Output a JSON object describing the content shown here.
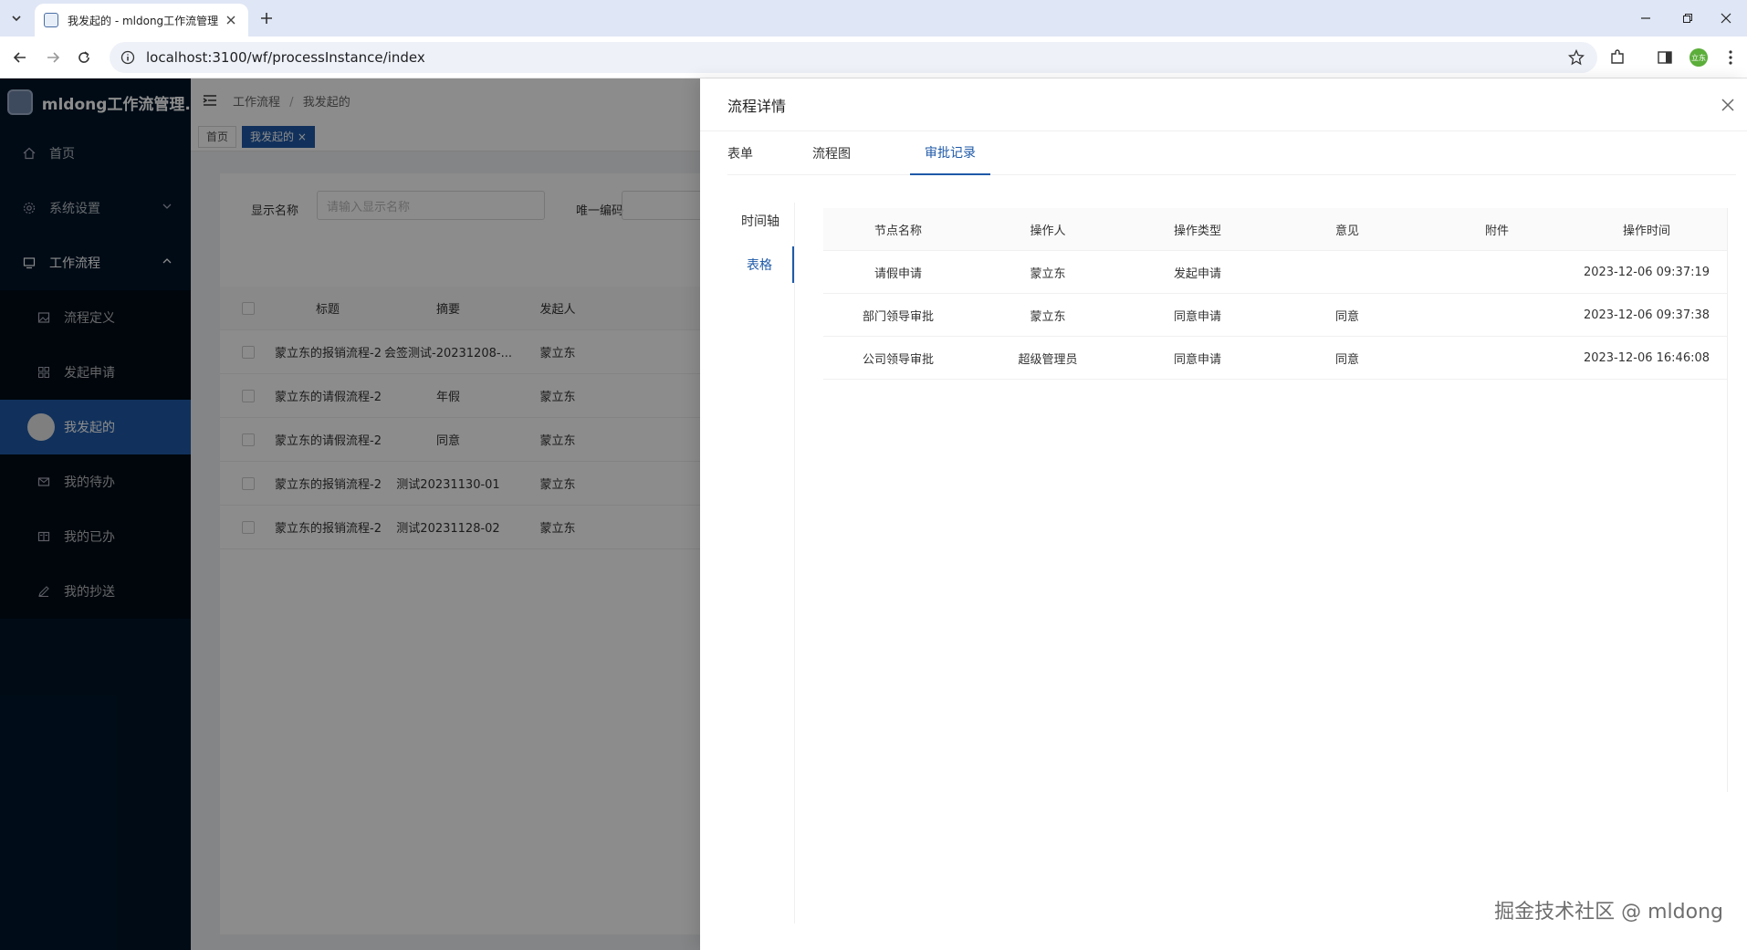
{
  "browser": {
    "tab_title": "我发起的 - mldong工作流管理",
    "url": "localhost:3100/wf/processInstance/index",
    "profile_text": "立东"
  },
  "app": {
    "brand": "mldong工作流管理...",
    "breadcrumb": [
      "工作流程",
      "我发起的"
    ],
    "open_tags": [
      {
        "label": "首页"
      },
      {
        "label": "我发起的 ×"
      }
    ]
  },
  "sidebar": {
    "items": [
      {
        "label": "首页",
        "icon": "home-icon"
      },
      {
        "label": "系统设置",
        "icon": "gear-icon"
      },
      {
        "label": "工作流程",
        "icon": "desktop-icon"
      }
    ],
    "sub_items": [
      {
        "label": "流程定义",
        "icon": "picture-icon"
      },
      {
        "label": "发起申请",
        "icon": "apps-icon"
      },
      {
        "label": "我发起的",
        "icon": "circle-icon"
      },
      {
        "label": "我的待办",
        "icon": "mail-icon"
      },
      {
        "label": "我的已办",
        "icon": "read-icon"
      },
      {
        "label": "我的抄送",
        "icon": "edit-icon"
      }
    ]
  },
  "search": {
    "display_name_label": "显示名称",
    "display_name_placeholder": "请输入显示名称",
    "unique_code_label": "唯一编码"
  },
  "list": {
    "columns": [
      "标题",
      "摘要",
      "发起人"
    ],
    "rows": [
      [
        "蒙立东的报销流程-2...",
        "会签测试-20231208-...",
        "蒙立东"
      ],
      [
        "蒙立东的请假流程-2...",
        "年假",
        "蒙立东"
      ],
      [
        "蒙立东的请假流程-2...",
        "同意",
        "蒙立东"
      ],
      [
        "蒙立东的报销流程-2...",
        "测试20231130-01",
        "蒙立东"
      ],
      [
        "蒙立东的报销流程-2...",
        "测试20231128-02",
        "蒙立东"
      ]
    ]
  },
  "drawer": {
    "title": "流程详情",
    "tabs": [
      "表单",
      "流程图",
      "审批记录"
    ],
    "active_tab": "审批记录",
    "side_tabs": [
      "时间轴",
      "表格"
    ],
    "active_side_tab": "表格",
    "columns": [
      "节点名称",
      "操作人",
      "操作类型",
      "意见",
      "附件",
      "操作时间"
    ],
    "records": [
      [
        "请假申请",
        "蒙立东",
        "发起申请",
        "",
        "",
        "2023-12-06 09:37:19"
      ],
      [
        "部门领导审批",
        "蒙立东",
        "同意申请",
        "同意",
        "",
        "2023-12-06 09:37:38"
      ],
      [
        "公司领导审批",
        "超级管理员",
        "同意申请",
        "同意",
        "",
        "2023-12-06 16:46:08"
      ]
    ]
  },
  "watermark": "掘金技术社区 @ mldong",
  "colors": {
    "primary": "#1f5aa8",
    "sidebar": "#001529"
  }
}
